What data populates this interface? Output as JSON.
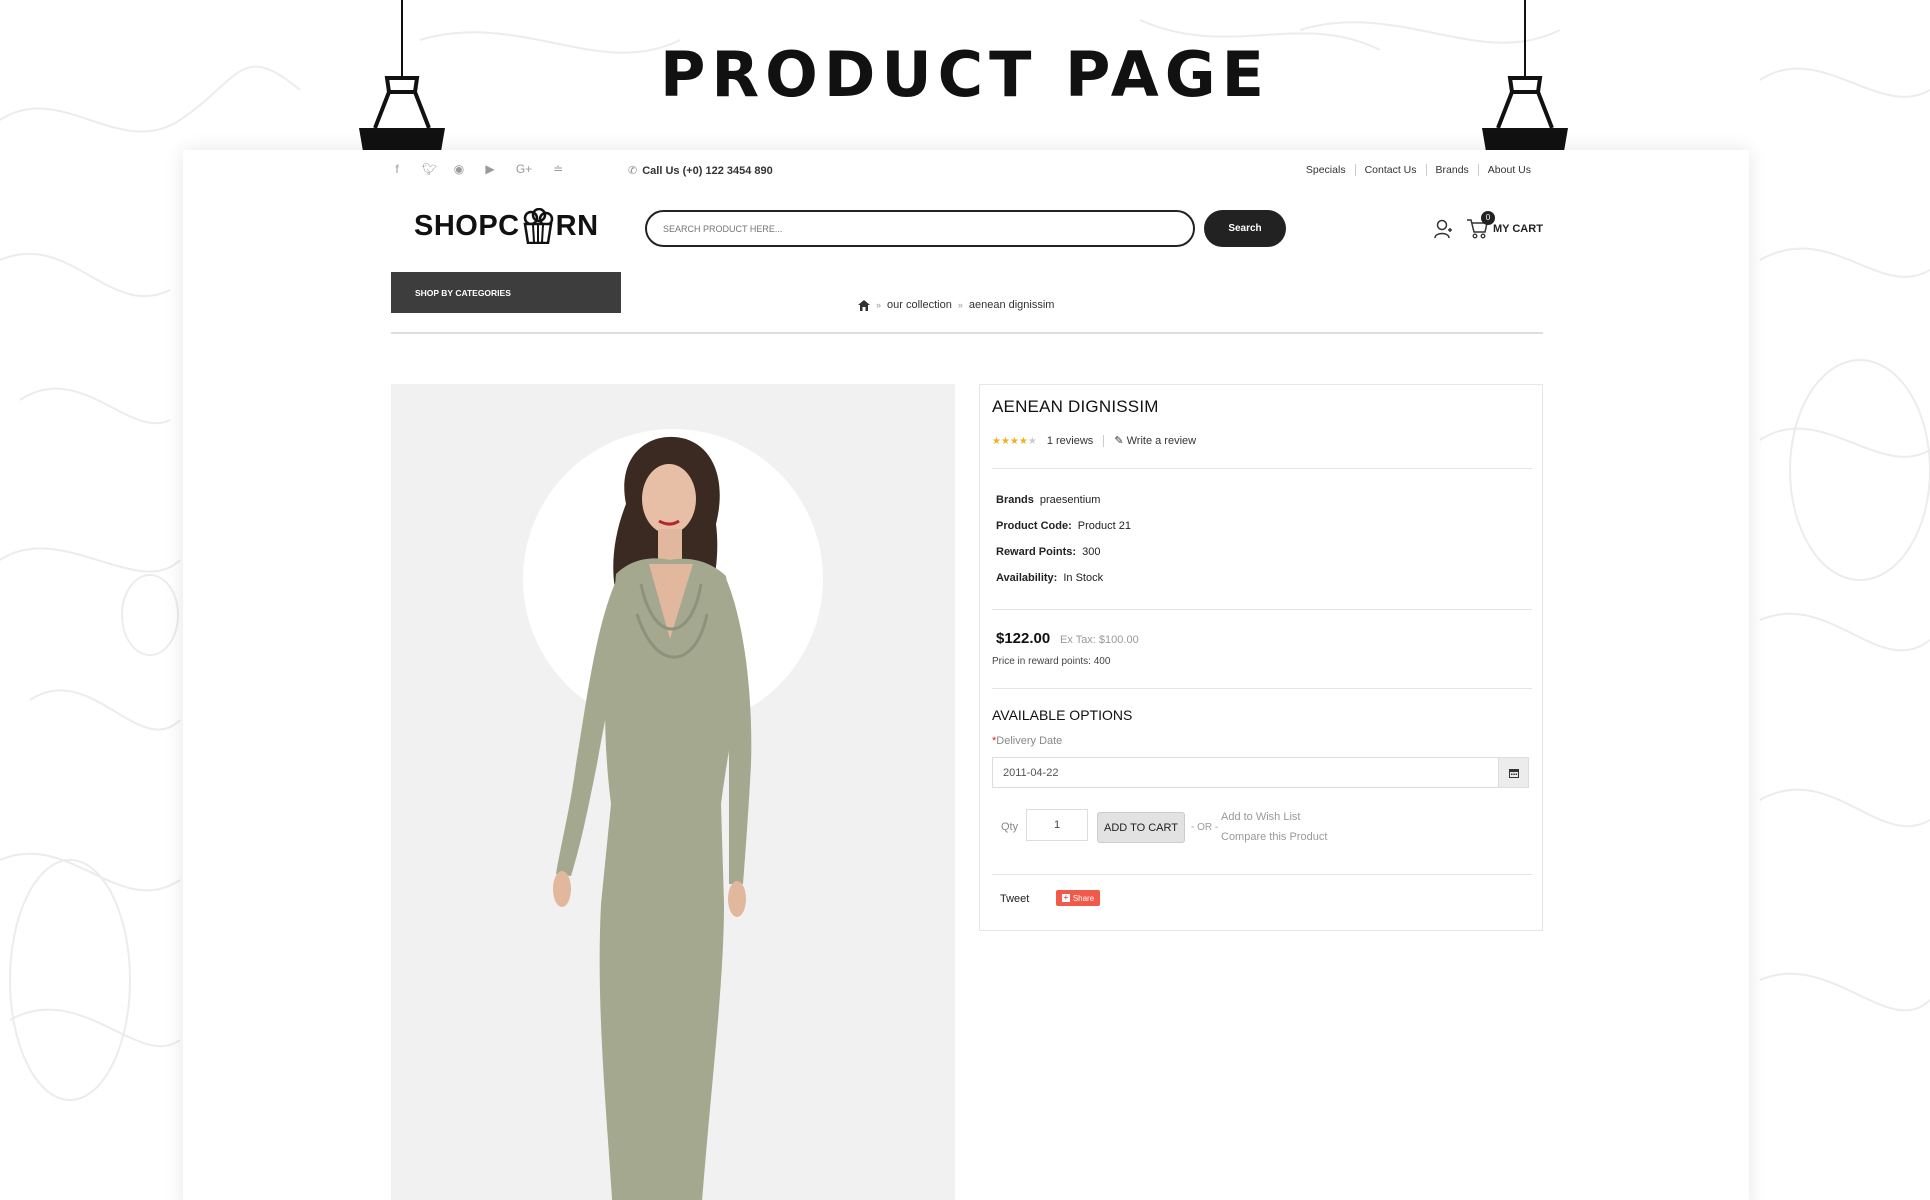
{
  "page_heading": "PRODUCT PAGE",
  "topbar": {
    "social_icons": [
      "facebook-icon",
      "twitter-icon",
      "instagram-icon",
      "youtube-icon",
      "google-plus-icon",
      "rss-icon"
    ],
    "call_text": "Call Us (+0) 122 3454 890",
    "links": [
      "Specials",
      "Contact Us",
      "Brands",
      "About Us"
    ]
  },
  "header": {
    "logo_left": "SHOPC",
    "logo_right": "RN",
    "search_placeholder": "SEARCH PRODUCT HERE...",
    "search_button": "Search",
    "cart_count": "0",
    "cart_label": "MY CART"
  },
  "nav": {
    "shop_by_categories": "SHOP BY CATEGORIES",
    "breadcrumb": [
      "our collection",
      "aenean dignissim"
    ]
  },
  "product": {
    "title": "AENEAN DIGNISSIM",
    "rating": 4,
    "rating_max": 5,
    "reviews": "1 reviews",
    "write_review": "Write a review",
    "brand_label": "Brands",
    "brand_value": "praesentium",
    "code_label": "Product Code:",
    "code_value": "Product 21",
    "reward_label": "Reward Points:",
    "reward_value": "300",
    "availability_label": "Availability:",
    "availability_value": "In Stock",
    "price": "$122.00",
    "ex_tax": "Ex Tax: $100.00",
    "reward_price": "Price in reward points: 400",
    "options_title": "AVAILABLE OPTIONS",
    "delivery_label": "Delivery Date",
    "delivery_value": "2011-04-22",
    "qty_label": "Qty",
    "qty_value": "1",
    "add_to_cart": "ADD TO CART",
    "or_text": "- OR -",
    "wish_list": "Add to Wish List",
    "compare": "Compare this Product",
    "tweet": "Tweet",
    "share": "Share"
  },
  "colors": {
    "dark": "#222222",
    "shop_categories_bg": "#3d3d3d",
    "star": "#f2b01e",
    "share": "#f15a4a",
    "dress": "#a3a88f"
  }
}
